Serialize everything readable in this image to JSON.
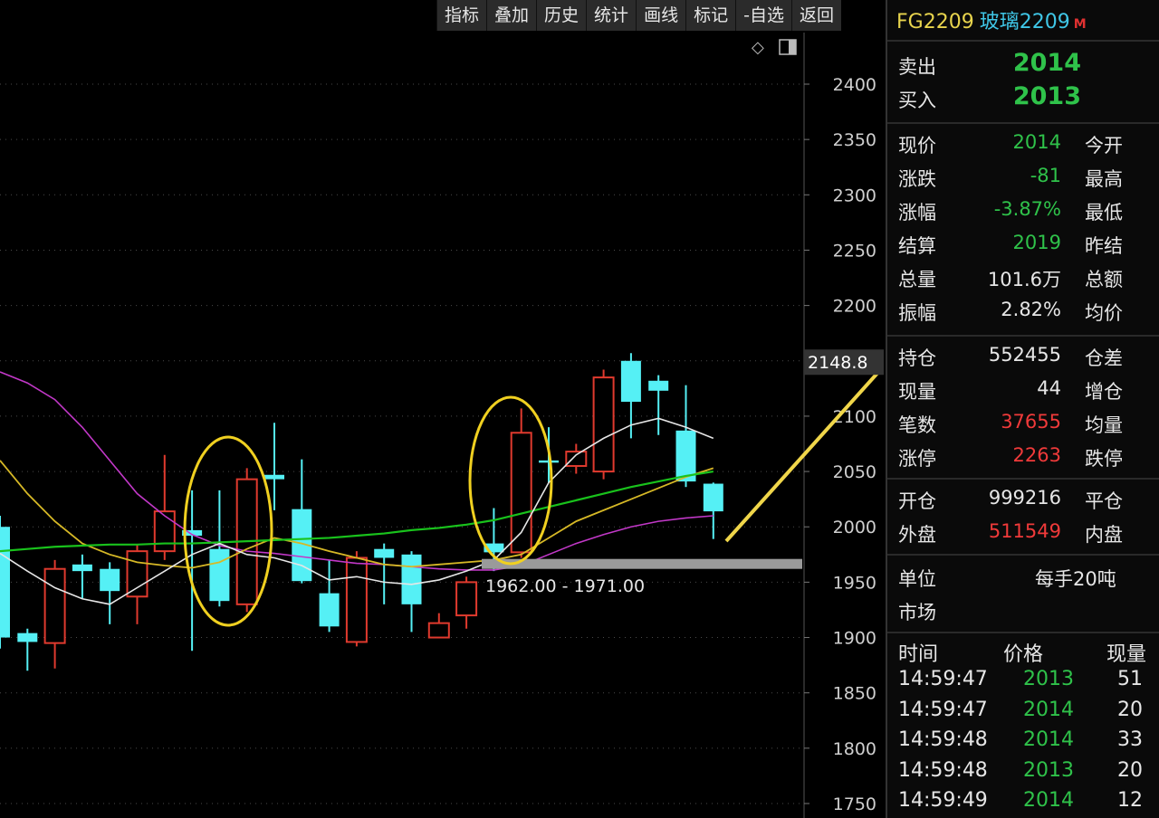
{
  "toolbar": {
    "buttons": [
      "指标",
      "叠加",
      "历史",
      "统计",
      "画线",
      "标记",
      "-自选",
      "返回"
    ]
  },
  "chart": {
    "price_label": "2148.8",
    "range_annotation": "1962.00 - 1971.00"
  },
  "chart_data": {
    "type": "candlestick",
    "y_ticks": [
      2400,
      2350,
      2300,
      2250,
      2200,
      2150,
      2100,
      2050,
      2000,
      1950,
      1900,
      1850,
      1800,
      1750
    ],
    "ylim": [
      1737,
      2470
    ],
    "candles": [
      {
        "o": 2000,
        "c": 1900,
        "h": 2010,
        "l": 1890,
        "dir": "down"
      },
      {
        "o": 1904,
        "c": 1896,
        "h": 1908,
        "l": 1870,
        "dir": "down"
      },
      {
        "o": 1895,
        "c": 1962,
        "h": 1970,
        "l": 1872,
        "dir": "up"
      },
      {
        "o": 1966,
        "c": 1960,
        "h": 1975,
        "l": 1935,
        "dir": "down"
      },
      {
        "o": 1962,
        "c": 1942,
        "h": 1968,
        "l": 1912,
        "dir": "down"
      },
      {
        "o": 1937,
        "c": 1978,
        "h": 1984,
        "l": 1912,
        "dir": "up"
      },
      {
        "o": 1978,
        "c": 2014,
        "h": 2065,
        "l": 1970,
        "dir": "up"
      },
      {
        "o": 1997,
        "c": 1992,
        "h": 2033,
        "l": 1888,
        "dir": "down"
      },
      {
        "o": 1980,
        "c": 1933,
        "h": 2033,
        "l": 1928,
        "dir": "down"
      },
      {
        "o": 1930,
        "c": 2043,
        "h": 2053,
        "l": 1923,
        "dir": "up"
      },
      {
        "o": 2047,
        "c": 2043,
        "h": 2094,
        "l": 2015,
        "dir": "down"
      },
      {
        "o": 2016,
        "c": 1951,
        "h": 2061,
        "l": 1949,
        "dir": "down"
      },
      {
        "o": 1940,
        "c": 1910,
        "h": 1970,
        "l": 1905,
        "dir": "down"
      },
      {
        "o": 1896,
        "c": 1972,
        "h": 1978,
        "l": 1892,
        "dir": "up"
      },
      {
        "o": 1980,
        "c": 1972,
        "h": 1985,
        "l": 1930,
        "dir": "down"
      },
      {
        "o": 1975,
        "c": 1930,
        "h": 1978,
        "l": 1905,
        "dir": "down"
      },
      {
        "o": 1900,
        "c": 1913,
        "h": 1922,
        "l": 1900,
        "dir": "up"
      },
      {
        "o": 1920,
        "c": 1950,
        "h": 1955,
        "l": 1908,
        "dir": "up"
      },
      {
        "o": 1985,
        "c": 1977,
        "h": 2017,
        "l": 1960,
        "dir": "down"
      },
      {
        "o": 1977,
        "c": 2085,
        "h": 2107,
        "l": 1972,
        "dir": "up"
      },
      {
        "o": 2060,
        "c": 2058,
        "h": 2090,
        "l": 2040,
        "dir": "down"
      },
      {
        "o": 2055,
        "c": 2068,
        "h": 2075,
        "l": 2048,
        "dir": "up"
      },
      {
        "o": 2050,
        "c": 2135,
        "h": 2142,
        "l": 2043,
        "dir": "up"
      },
      {
        "o": 2150,
        "c": 2113,
        "h": 2157,
        "l": 2080,
        "dir": "down"
      },
      {
        "o": 2132,
        "c": 2123,
        "h": 2137,
        "l": 2083,
        "dir": "down"
      },
      {
        "o": 2087,
        "c": 2041,
        "h": 2128,
        "l": 2036,
        "dir": "down"
      },
      {
        "o": 2039,
        "c": 2014,
        "h": 2040,
        "l": 1989,
        "dir": "down"
      }
    ],
    "ma_white": [
      1976,
      1960,
      1945,
      1935,
      1930,
      1945,
      1960,
      1975,
      1985,
      1975,
      1972,
      1965,
      1952,
      1955,
      1950,
      1948,
      1952,
      1960,
      1970,
      1995,
      2040,
      2065,
      2080,
      2092,
      2098,
      2090,
      2080
    ],
    "ma_yellow": [
      2060,
      2030,
      2005,
      1985,
      1975,
      1968,
      1965,
      1963,
      1968,
      1980,
      1990,
      1985,
      1978,
      1972,
      1966,
      1964,
      1966,
      1968,
      1970,
      1975,
      1990,
      2005,
      2015,
      2025,
      2035,
      2045,
      2053
    ],
    "ma_green": [
      1978,
      1980,
      1982,
      1983,
      1984,
      1984,
      1985,
      1985,
      1986,
      1987,
      1988,
      1989,
      1990,
      1992,
      1994,
      1997,
      1999,
      2002,
      2006,
      2012,
      2018,
      2024,
      2030,
      2036,
      2041,
      2046,
      2050
    ],
    "ma_magenta": [
      2140,
      2130,
      2115,
      2090,
      2060,
      2030,
      2010,
      1993,
      1983,
      1978,
      1976,
      1973,
      1970,
      1967,
      1966,
      1964,
      1962,
      1961,
      1961,
      1965,
      1975,
      1985,
      1993,
      2000,
      2005,
      2008,
      2010
    ]
  },
  "quote": {
    "code": "FG2209",
    "name": "玻璃2209",
    "market_flag": "M",
    "sell_label": "卖出",
    "sell_value": "2014",
    "buy_label": "买入",
    "buy_value": "2013",
    "rows": [
      {
        "label": "现价",
        "value": "2014",
        "color": "#2fc24a",
        "label2": "今开"
      },
      {
        "label": "涨跌",
        "value": "-81",
        "color": "#2fc24a",
        "label2": "最高"
      },
      {
        "label": "涨幅",
        "value": "-3.87%",
        "color": "#2fc24a",
        "label2": "最低"
      },
      {
        "label": "结算",
        "value": "2019",
        "color": "#2fc24a",
        "label2": "昨结"
      },
      {
        "label": "总量",
        "value": "101.6万",
        "color": "#e6e6e6",
        "label2": "总额"
      },
      {
        "label": "振幅",
        "value": "2.82%",
        "color": "#e6e6e6",
        "label2": "均价"
      }
    ],
    "rows2": [
      {
        "label": "持仓",
        "value": "552455",
        "color": "#e6e6e6",
        "label2": "仓差"
      },
      {
        "label": "现量",
        "value": "44",
        "color": "#e6e6e6",
        "label2": "增仓"
      },
      {
        "label": "笔数",
        "value": "37655",
        "color": "#f03a3a",
        "label2": "均量"
      },
      {
        "label": "涨停",
        "value": "2263",
        "color": "#f03a3a",
        "label2": "跌停"
      }
    ],
    "rows3": [
      {
        "label": "开仓",
        "value": "999216",
        "color": "#e6e6e6",
        "label2": "平仓"
      },
      {
        "label": "外盘",
        "value": "511549",
        "color": "#f03a3a",
        "label2": "内盘"
      }
    ],
    "unit_label": "单位",
    "unit_value": "每手20吨",
    "market_label": "市场",
    "ticks_header": {
      "time": "时间",
      "price": "价格",
      "volume": "现量"
    },
    "ticks": [
      {
        "time": "14:59:47",
        "price": "2013",
        "volume": "51"
      },
      {
        "time": "14:59:47",
        "price": "2014",
        "volume": "20"
      },
      {
        "time": "14:59:48",
        "price": "2014",
        "volume": "33"
      },
      {
        "time": "14:59:48",
        "price": "2013",
        "volume": "20"
      },
      {
        "time": "14:59:49",
        "price": "2014",
        "volume": "12"
      }
    ]
  },
  "colors": {
    "up": "#e03a2e",
    "down": "#55f0f5",
    "ma_white": "#e6e6e6",
    "ma_yellow": "#d6b826",
    "ma_green": "#19c21c",
    "ma_magenta": "#c238c8",
    "highlight_ellipse": "#f0d020",
    "arrow": "#f0d64a"
  }
}
